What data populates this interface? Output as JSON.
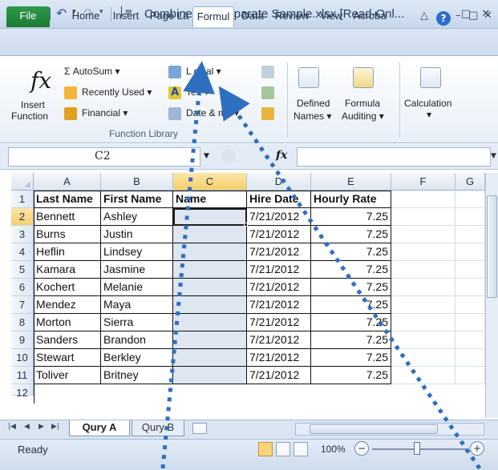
{
  "window": {
    "title": "Combine and Separate Sample.xlsx  [Read-Onl...",
    "app_icon": "X",
    "controls": {
      "minimize": "–",
      "restore": "□",
      "close": "✕"
    }
  },
  "quick_access": {
    "undo": "↶",
    "redo": "↷",
    "dropdown": "▾",
    "customize": "│≡"
  },
  "tabs": [
    {
      "id": "file",
      "label": "File"
    },
    {
      "id": "home",
      "label": "Home"
    },
    {
      "id": "insert",
      "label": "Insert"
    },
    {
      "id": "page_layout",
      "label": "Page Lá"
    },
    {
      "id": "formulas",
      "label": "Formul"
    },
    {
      "id": "data",
      "label": "Data"
    },
    {
      "id": "review",
      "label": "Review"
    },
    {
      "id": "view",
      "label": "View"
    },
    {
      "id": "acrobat",
      "label": "Acroba"
    }
  ],
  "ribbon_controls": {
    "minimize_ribbon": "△",
    "help": "?",
    "minimize": "–",
    "restore": "□",
    "close": "✕"
  },
  "ribbon": {
    "insert_function": {
      "line1": "Insert",
      "line2": "Function",
      "icon": "fx"
    },
    "autosum": "Σ AutoSum ▾",
    "recently_used": "Recently Used ▾",
    "financial": "Financial ▾",
    "logical": "L  gical ▾",
    "text": "Te  t ▾",
    "date_time": "Date &   me ▾",
    "defined_names": {
      "line1": "Defined",
      "line2": "Names ▾"
    },
    "formula_auditing": {
      "line1": "Formula",
      "line2": "Auditing ▾"
    },
    "calculation": {
      "line1": "Calculation",
      "line2": "▾"
    },
    "group_label": "Function Library"
  },
  "formula_bar": {
    "name_box": "C2",
    "fx": "fx",
    "formula": ""
  },
  "columns": [
    "A",
    "B",
    "C",
    "D",
    "E",
    "F",
    "G"
  ],
  "rows": [
    "1",
    "2",
    "3",
    "4",
    "5",
    "6",
    "7",
    "8",
    "9",
    "10",
    "11",
    "12"
  ],
  "table": {
    "headers": [
      "Last Name",
      "First Name",
      "Name",
      "Hire Date",
      "Hourly Rate"
    ],
    "data": [
      [
        "Bennett",
        "Ashley",
        "",
        "7/21/2012",
        "7.25"
      ],
      [
        "Burns",
        "Justin",
        "",
        "7/21/2012",
        "7.25"
      ],
      [
        "Heflin",
        "Lindsey",
        "",
        "7/21/2012",
        "7.25"
      ],
      [
        "Kamara",
        "Jasmine",
        "",
        "7/21/2012",
        "7.25"
      ],
      [
        "Kochert",
        "Melanie",
        "",
        "7/21/2012",
        "7.25"
      ],
      [
        "Mendez",
        "Maya",
        "",
        "7/21/2012",
        "7.25"
      ],
      [
        "Morton",
        "Sierra",
        "",
        "7/21/2012",
        "7.25"
      ],
      [
        "Sanders",
        "Brandon",
        "",
        "7/21/2012",
        "7.25"
      ],
      [
        "Stewart",
        "Berkley",
        "",
        "7/21/2012",
        "7.25"
      ],
      [
        "Toliver",
        "Britney",
        "",
        "7/21/2012",
        "7.25"
      ]
    ]
  },
  "active_cell": "C2",
  "sheets": [
    {
      "label": "Qury A",
      "active": true
    },
    {
      "label": "Qury B",
      "active": false
    }
  ],
  "status": {
    "ready": "Ready",
    "zoom": "100%",
    "zoom_out": "−",
    "zoom_in": "+"
  },
  "colors": {
    "selection": "#dde6f1",
    "accent_green": "#1d7a3a",
    "arrow_blue": "#2f6fbf"
  }
}
